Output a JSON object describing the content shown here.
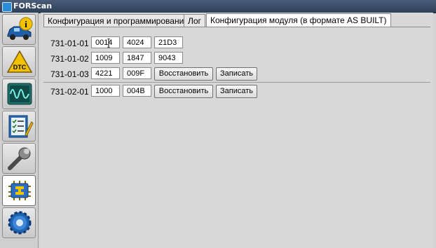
{
  "app": {
    "title": "FORScan"
  },
  "sidebar": {
    "items": [
      {
        "name": "info"
      },
      {
        "name": "dtc",
        "label": "DTC"
      },
      {
        "name": "oscilloscope"
      },
      {
        "name": "checklist"
      },
      {
        "name": "service"
      },
      {
        "name": "module-configuration"
      },
      {
        "name": "settings"
      }
    ],
    "active_index": 5
  },
  "tabs": [
    {
      "label": "Конфигурация и программирование",
      "active": false
    },
    {
      "label": "Лог",
      "active": false
    },
    {
      "label": "Конфигурация модуля (в формате AS BUILT)",
      "active": true
    }
  ],
  "config_rows": [
    {
      "address": "731-01-01",
      "values": [
        "0014",
        "4024",
        "21D3"
      ],
      "buttons": []
    },
    {
      "address": "731-01-02",
      "values": [
        "1009",
        "1847",
        "9043"
      ],
      "buttons": []
    },
    {
      "address": "731-01-03",
      "values": [
        "4221",
        "009F"
      ],
      "buttons": [
        "Восстановить",
        "Записать"
      ]
    },
    {
      "address": "731-02-01",
      "values": [
        "1000",
        "004B"
      ],
      "buttons": [
        "Восстановить",
        "Записать"
      ]
    }
  ],
  "colors": {
    "titlebar": "#34465f",
    "accent": "#2a8bd8"
  }
}
